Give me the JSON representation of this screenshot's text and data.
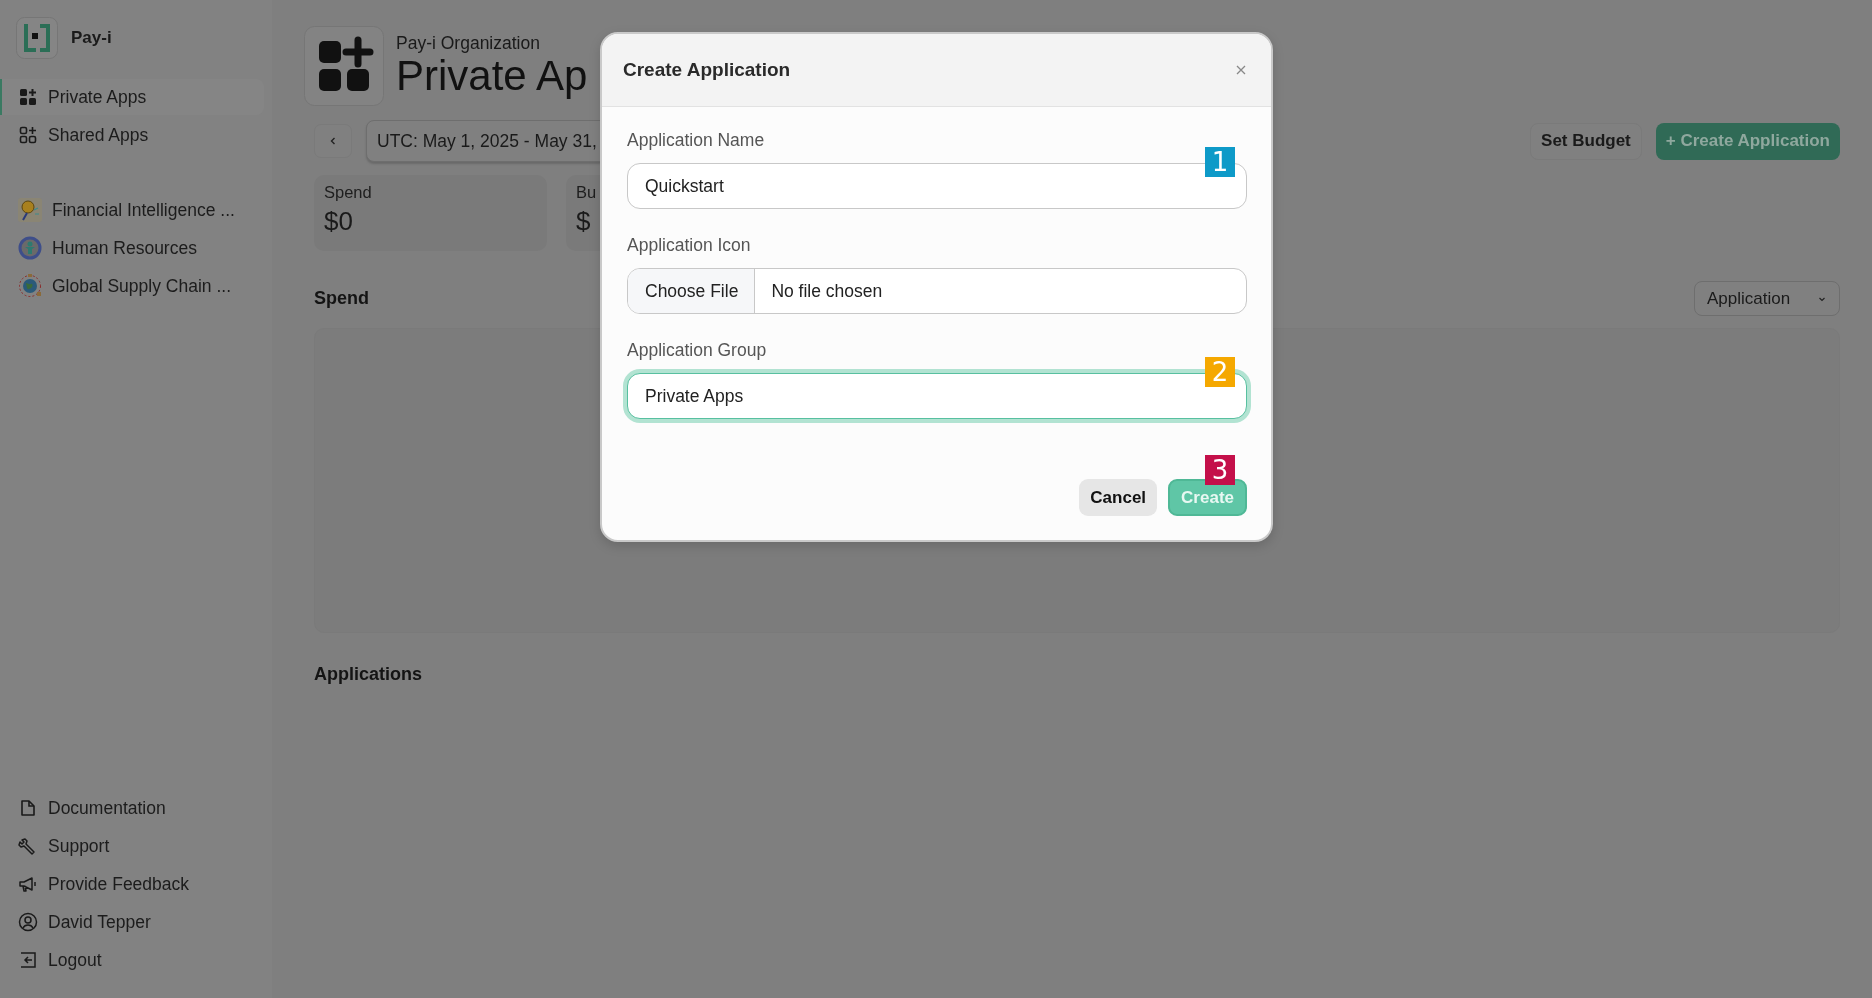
{
  "sidebar": {
    "brand": "Pay-i",
    "nav": [
      {
        "label": "Private Apps",
        "kind": "private",
        "selected": true
      },
      {
        "label": "Shared Apps",
        "kind": "shared",
        "selected": false
      }
    ],
    "apps": [
      {
        "label": "Financial Intelligence ...",
        "kind": "finance"
      },
      {
        "label": "Human Resources",
        "kind": "people"
      },
      {
        "label": "Global Supply Chain ...",
        "kind": "globe"
      }
    ],
    "footer": [
      {
        "label": "Documentation",
        "kind": "doc"
      },
      {
        "label": "Support",
        "kind": "wrench"
      },
      {
        "label": "Provide Feedback",
        "kind": "megaphone"
      },
      {
        "label": "David Tepper",
        "kind": "user"
      },
      {
        "label": "Logout",
        "kind": "logout"
      }
    ]
  },
  "header": {
    "subtitle": "Pay-i Organization",
    "title": "Private Ap"
  },
  "toolbar": {
    "date_range": "UTC: May 1, 2025 - May 31,",
    "buttons": [
      {
        "label": "Set Budget",
        "kind": "secondary"
      },
      {
        "label": "+ Create Application",
        "kind": "primary"
      }
    ]
  },
  "cards": [
    {
      "label": "Spend",
      "value": "$0"
    },
    {
      "label": "Bu",
      "value": "$"
    }
  ],
  "spend_section": {
    "title": "Spend",
    "group_by": "Application"
  },
  "applications_section": {
    "title": "Applications"
  },
  "dialog": {
    "title": "Create Application",
    "fields": [
      {
        "label": "Application Name",
        "kind": "text",
        "value": "Quickstart",
        "focused": false,
        "marker": {
          "label": "1",
          "color": "#0e9ac8"
        }
      },
      {
        "label": "Application Icon",
        "kind": "file",
        "button": "Choose File",
        "value": "No file chosen"
      },
      {
        "label": "Application Group",
        "kind": "text",
        "value": "Private Apps",
        "focused": true,
        "marker": {
          "label": "2",
          "color": "#f5a800"
        }
      }
    ],
    "buttons": [
      {
        "label": "Cancel",
        "kind": "secondary"
      },
      {
        "label": "Create",
        "kind": "primary",
        "marker": {
          "label": "3",
          "color": "#c4104a"
        }
      }
    ]
  }
}
